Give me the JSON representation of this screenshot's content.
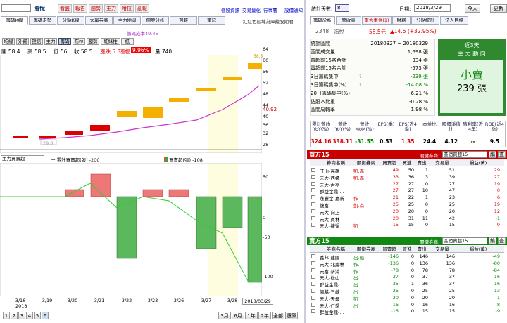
{
  "left_toolbar": {
    "stock": "海悅",
    "buttons": [
      "看盤",
      "報告",
      "趨勢",
      "主力",
      "哈拉",
      "亂報"
    ],
    "links": [
      "個股資訊",
      "交易量化",
      "行事曆",
      "設價通知"
    ]
  },
  "left_tabs": [
    "籌碼K線",
    "籌碼走勢",
    "分點K線",
    "大單券商",
    "主力地圖",
    "個股分析",
    "週報",
    "筆記"
  ],
  "tab_note": "紅紅色區塊為庫藏股期間",
  "sub_tabs": [
    "均線",
    "外資",
    "投信",
    "主力",
    "籌碼",
    "布林",
    "趨勢",
    "紅綠柱",
    "紙"
  ],
  "avg_cost_label": "籌碼成本49.45",
  "ohlc": {
    "open": "開 58.4",
    "high": "高 58.5",
    "low": "低 56",
    "close": "收 58.5",
    "chg": "漲跌 5.3",
    "pct_label": "漲幅",
    "pct": "9.96%",
    "vol": "量 740"
  },
  "price_axis": [
    "64",
    "56",
    "48",
    "40",
    "32",
    "28"
  ],
  "price_axis2": [
    "60",
    "52",
    "44",
    "36"
  ],
  "price_current": "40.92",
  "low_label": "29.8",
  "high_label": "58.5",
  "lower_header": {
    "select": "主力買賣超",
    "cum_legend": "一 累計買賣超(張) -200",
    "bar_legend": "買賣超(張) -108"
  },
  "lower_axis": [
    "50",
    "0",
    "-50",
    "-100"
  ],
  "x_dates": [
    "3/16",
    "3/19",
    "3/20",
    "3/21",
    "3/22",
    "3/23",
    "3/26",
    "3/27",
    "3/28",
    "2018/03/29"
  ],
  "x_year": "2018",
  "bottom_nav": {
    "pages": [
      "1",
      "2",
      "3",
      "4",
      "5",
      "6"
    ],
    "range": [
      "3月",
      "6月",
      "1年",
      "2年",
      "全部",
      "還原"
    ]
  },
  "right_top": {
    "stat_label": "統計天數:",
    "stat_days": "8",
    "date_label": "日期:",
    "date": "2018/3/29",
    "today": "今天",
    "refresh": "更新"
  },
  "right_tabs": [
    "籌碼分析",
    "營收表",
    "重大事件(1)",
    "財務",
    "分點統計",
    "法人目標"
  ],
  "stock_line": {
    "code": "2348",
    "name": "海悅",
    "price": "58.5元",
    "chg": "▲14.5 (+32.95%)"
  },
  "stats": [
    {
      "k": "統計區間",
      "v": "20180327 ~ 20180329"
    },
    {
      "k": "區間成交量",
      "v": "1,698 張"
    },
    {
      "k": "買超前15名合計",
      "v": "334 張"
    },
    {
      "k": "賣超前15名合計",
      "v": "-573 張"
    },
    {
      "k": "3日籌碼集中",
      "v": "-239 張"
    },
    {
      "k": "3日籌碼集中(%)",
      "v": "-14.08 %"
    },
    {
      "k": "20日籌碼集中(%)",
      "v": "-6.21 %"
    },
    {
      "k": "佔股本比重",
      "v": "-0.28 %"
    },
    {
      "k": "區間周轉率",
      "v": "1.98 %"
    }
  ],
  "main_force": {
    "title1": "近3天",
    "title2": "主 力 動 向",
    "verdict": "小賣",
    "amount": "239 張"
  },
  "fin_headers": [
    "累計營收YoY(%)",
    "營收YoY(%)",
    "營收MoM(%)",
    "EPS(季)",
    "EPS(近4季)",
    "本益比",
    "股價淨值比",
    "殖利率(近4年)",
    "ROE(近4季)"
  ],
  "fin_values": [
    "324.16",
    "338.11",
    "-31.55",
    "0.53",
    "1.35",
    "24.4",
    "4.12",
    "--",
    "9.5"
  ],
  "buy_panel": {
    "title": "買方15",
    "select_label": "關鍵券商:",
    "select": "區間買超15",
    "btn1": "編",
    "btn2": "查",
    "headers": [
      "券商名稱",
      "關鍵券商",
      "買賣超",
      "買進",
      "賣出",
      "交易量",
      "損益(萬)"
    ],
    "rows": [
      [
        "王山-高雄",
        "凱.森",
        "49",
        "50",
        "1",
        "51",
        "29"
      ],
      [
        "元大-西螺",
        "凱.森",
        "33",
        "36",
        "3",
        "39",
        "27"
      ],
      [
        "元大-古亭",
        "",
        "27",
        "27",
        "0",
        "27",
        "19"
      ],
      [
        "群益金鼎-...",
        "",
        "27",
        "27",
        "10",
        "47",
        "0"
      ],
      [
        "永豐金-嘉新",
        "作",
        "21",
        "22",
        "1",
        "23",
        "6"
      ],
      [
        "復富",
        "凱.森",
        "25",
        "25",
        "0",
        "25",
        "19"
      ],
      [
        "元大-向上",
        "",
        "20",
        "20",
        "0",
        "20",
        "12"
      ],
      [
        "元大-員林",
        "",
        "20",
        "31",
        "11",
        "42",
        "-1"
      ],
      [
        "元大-捷運",
        "凱",
        "15",
        "15",
        "0",
        "15",
        "9"
      ]
    ]
  },
  "sell_panel": {
    "title": "賣方15",
    "select_label": "關鍵券商:",
    "select": "區間賣超15",
    "btn1": "編",
    "btn2": "查",
    "headers": [
      "券商名稱",
      "關鍵券商",
      "買賣超",
      "買進",
      "賣出",
      "交易量",
      "損益(萬)"
    ],
    "rows": [
      [
        "富邦-建國",
        "出.船",
        "-146",
        "0",
        "146",
        "146",
        "-49"
      ],
      [
        "元大-北農林",
        "作.",
        "-136",
        "0",
        "136",
        "136",
        "-80"
      ],
      [
        "元富-新浦",
        "作",
        "-78",
        "0",
        "78",
        "78",
        "-84"
      ],
      [
        "元大-松山",
        "出",
        "-37",
        "0",
        "37",
        "37",
        "-16"
      ],
      [
        "群益金鼎-...",
        "出",
        "-35",
        "1",
        "36",
        "37",
        "-16"
      ],
      [
        "凱基-三峽",
        "出",
        "-25",
        "0",
        "25",
        "25",
        "-13"
      ],
      [
        "元大-天母",
        "凱",
        "-20",
        "0",
        "20",
        "20",
        "-1"
      ],
      [
        "元大-仁愛",
        "出",
        "-16",
        "0",
        "16",
        "16",
        "-8"
      ],
      [
        "群益金鼎-...",
        "",
        "-15",
        "0",
        "15",
        "15",
        "-9"
      ]
    ]
  }
}
